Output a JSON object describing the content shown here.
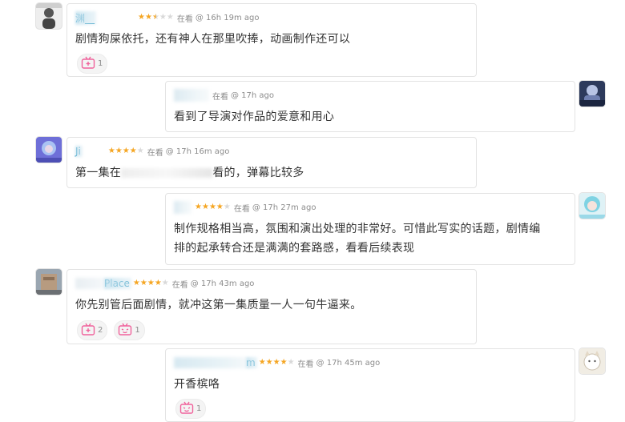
{
  "comments": [
    {
      "username": "渊__",
      "status": "在看",
      "time": "@ 16h 19m ago",
      "rating": 2.5,
      "text": "剧情狗屎依托，还有神人在那里吹捧，动画制作还可以",
      "reactions": [
        {
          "icon": "tv-plus-icon",
          "count": "1"
        }
      ]
    },
    {
      "username": "",
      "status": "在看",
      "time": "@ 17h ago",
      "rating": 0,
      "text": "看到了导演对作品的爱意和用心",
      "reactions": []
    },
    {
      "username": "Ji",
      "status": "在看",
      "time": "@ 17h 16m ago",
      "rating": 4,
      "text_before": "第一集在",
      "text_after": "看的，弹幕比较多",
      "reactions": []
    },
    {
      "username": "",
      "status": "在看",
      "time": "@ 17h 27m ago",
      "rating": 4,
      "text_line1": "制作规格相当高，氛围和演出处理的非常好。可惜此写实的话题，剧情编",
      "text_line2": "排的起承转合还是满满的套路感，看看后续表现",
      "reactions": []
    },
    {
      "username": "Place",
      "status": "在看",
      "time": "@ 17h 43m ago",
      "rating": 4,
      "text": "你先别管后面剧情，就冲这第一集质量一人一句牛逼来。",
      "reactions": [
        {
          "icon": "tv-plus-icon",
          "count": "2"
        },
        {
          "icon": "tv-face-icon",
          "count": "1"
        }
      ]
    },
    {
      "username": "m",
      "status": "在看",
      "time": "@ 17h 45m ago",
      "rating": 4,
      "text": "开香槟咯",
      "reactions": [
        {
          "icon": "tv-face-icon",
          "count": "1"
        }
      ]
    }
  ],
  "colors": {
    "star": "#f5a623",
    "name": "#0084b4",
    "reaction_icon": "#f0629b"
  }
}
